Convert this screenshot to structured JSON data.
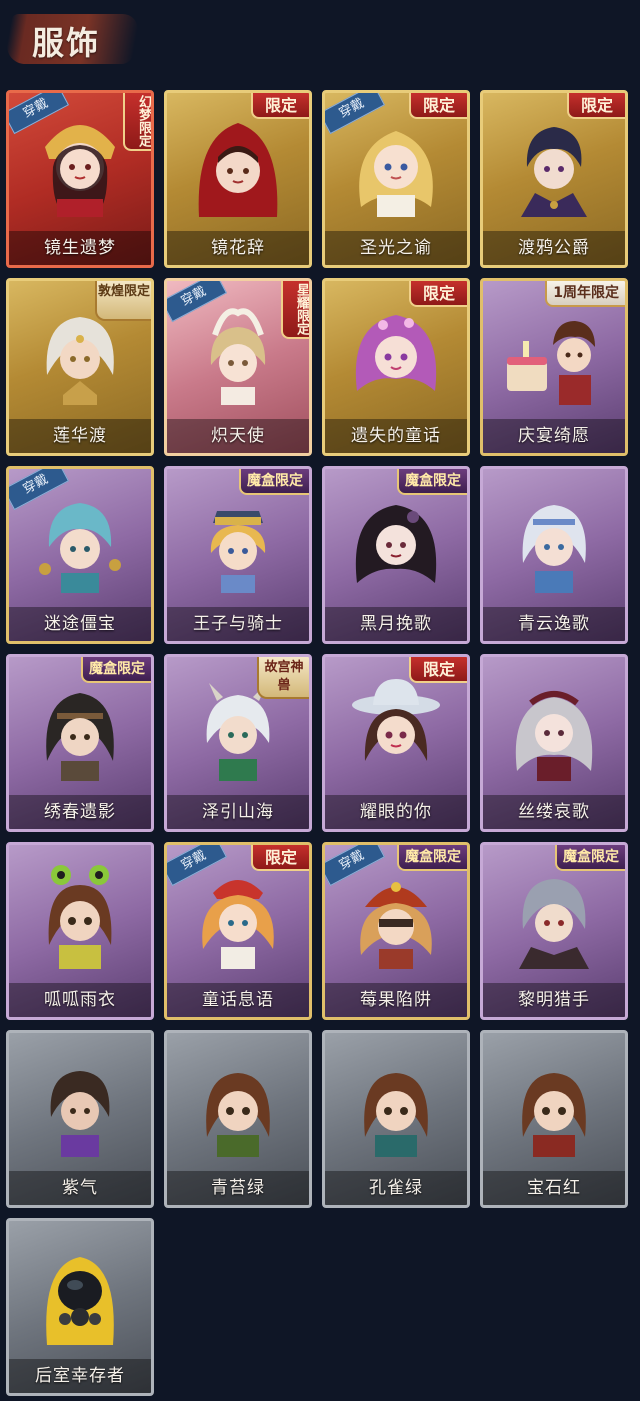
{
  "header": {
    "title": "服饰"
  },
  "cards": [
    {
      "name": "镜生遗梦",
      "worn": "穿戴",
      "tag": "幻梦限定",
      "portrait": "bride-icon"
    },
    {
      "name": "镜花辞",
      "tag": "限定",
      "portrait": "red-hood-icon"
    },
    {
      "name": "圣光之谕",
      "worn": "穿戴",
      "tag": "限定",
      "portrait": "golden-hair-icon"
    },
    {
      "name": "渡鸦公爵",
      "tag": "限定",
      "portrait": "raven-duke-icon"
    },
    {
      "name": "莲华渡",
      "tag": "敦煌限定",
      "portrait": "lotus-icon"
    },
    {
      "name": "炽天使",
      "worn": "穿戴",
      "tag": "星耀限定",
      "portrait": "angel-icon"
    },
    {
      "name": "遗失的童话",
      "tag": "限定",
      "portrait": "fairy-tale-icon"
    },
    {
      "name": "庆宴绮愿",
      "tag": "1周年限定",
      "portrait": "cake-icon"
    },
    {
      "name": "迷途僵宝",
      "worn": "穿戴",
      "portrait": "jiangshi-icon"
    },
    {
      "name": "王子与骑士",
      "tag": "魔盒限定",
      "portrait": "prince-icon"
    },
    {
      "name": "黑月挽歌",
      "tag": "魔盒限定",
      "portrait": "dark-moon-icon"
    },
    {
      "name": "青云逸歌",
      "portrait": "blue-cloud-icon"
    },
    {
      "name": "绣春遗影",
      "tag": "魔盒限定",
      "portrait": "swordsman-icon"
    },
    {
      "name": "泽引山海",
      "tag": "故宫神兽",
      "portrait": "mountain-sea-icon"
    },
    {
      "name": "耀眼的你",
      "tag": "限定",
      "portrait": "cowgirl-icon"
    },
    {
      "name": "丝缕哀歌",
      "portrait": "lace-elegy-icon"
    },
    {
      "name": "呱呱雨衣",
      "portrait": "frog-raincoat-icon"
    },
    {
      "name": "童话息语",
      "worn": "穿戴",
      "tag": "限定",
      "portrait": "fairy-whisper-icon"
    },
    {
      "name": "莓果陷阱",
      "worn": "穿戴",
      "tag": "魔盒限定",
      "portrait": "berry-trap-icon"
    },
    {
      "name": "黎明猎手",
      "tag": "魔盒限定",
      "portrait": "dawn-hunter-icon"
    },
    {
      "name": "紫气",
      "portrait": "violet-icon"
    },
    {
      "name": "青苔绿",
      "portrait": "moss-green-icon"
    },
    {
      "name": "孔雀绿",
      "portrait": "peacock-green-icon"
    },
    {
      "name": "宝石红",
      "portrait": "ruby-red-icon"
    },
    {
      "name": "后室幸存者",
      "portrait": "hazmat-survivor-icon"
    }
  ],
  "colors": {
    "background": "#0f1626",
    "gold": "#e8cc7a",
    "purple": "#8e6aa4",
    "gray": "#6f757e"
  }
}
